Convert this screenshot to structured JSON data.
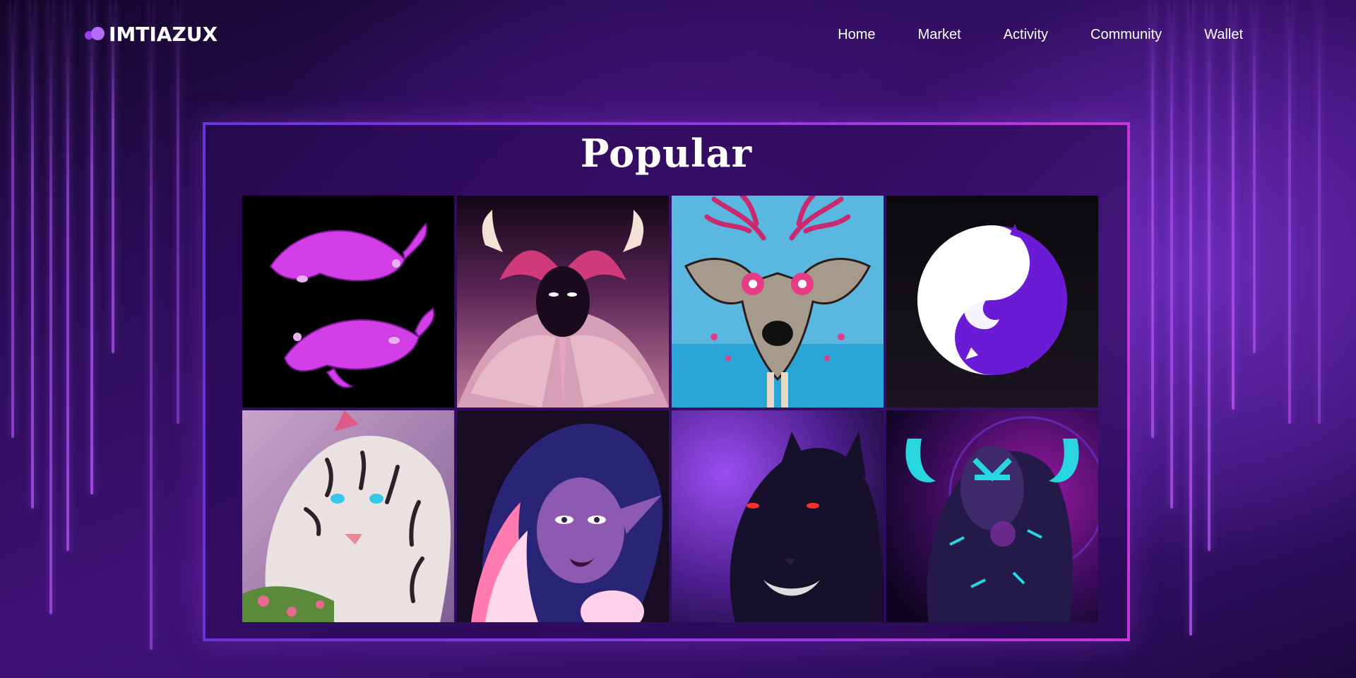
{
  "brand": {
    "name": "IMTIAZUX",
    "accent": "#9b3df0"
  },
  "nav": {
    "items": [
      {
        "label": "Home"
      },
      {
        "label": "Market"
      },
      {
        "label": "Activity"
      },
      {
        "label": "Community"
      },
      {
        "label": "Wallet"
      }
    ]
  },
  "gallery": {
    "title": "Popular",
    "items": [
      {
        "icon": "koi-fish-artwork"
      },
      {
        "icon": "mystic-woman-artwork"
      },
      {
        "icon": "stag-mask-artwork"
      },
      {
        "icon": "yin-yang-cat-artwork"
      },
      {
        "icon": "white-tiger-artwork"
      },
      {
        "icon": "elf-girl-artwork"
      },
      {
        "icon": "black-panther-artwork"
      },
      {
        "icon": "cyber-demon-artwork"
      }
    ]
  }
}
